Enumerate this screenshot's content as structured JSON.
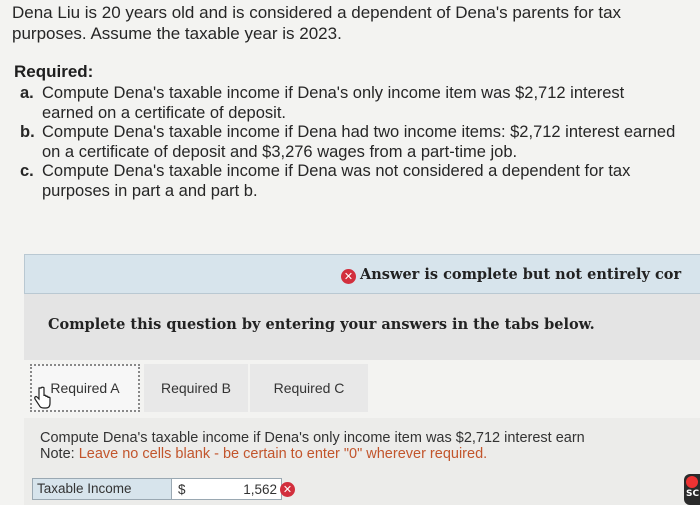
{
  "intro": "Dena Liu is 20 years old and is considered a dependent of Dena's parents for tax purposes. Assume the taxable year is 2023.",
  "required_heading": "Required:",
  "parts": [
    {
      "letter": "a.",
      "text": "Compute Dena's taxable income if Dena's only income item was $2,712 interest earned on a certificate of deposit."
    },
    {
      "letter": "b.",
      "text": "Compute Dena's taxable income if Dena had two income items: $2,712 interest earned on a certificate of deposit and $3,276 wages from a part-time job."
    },
    {
      "letter": "c.",
      "text": "Compute Dena's taxable income if Dena was not considered a dependent for tax purposes in part a and part b."
    }
  ],
  "status": {
    "message": "Answer is complete but not entirely cor",
    "icon": "x-circle-icon",
    "color": "#d22f3d"
  },
  "instruction": "Complete this question by entering your answers in the tabs below.",
  "tabs": [
    {
      "label": "Required A",
      "active": true
    },
    {
      "label": "Required B",
      "active": false
    },
    {
      "label": "Required C",
      "active": false
    }
  ],
  "panel": {
    "question": "Compute Dena's taxable income if Dena's only income item was $2,712 interest earn",
    "note_label": "Note:",
    "note_body": " Leave no cells blank - be certain to enter \"0\" wherever required.",
    "field_label": "Taxable Income",
    "currency": "$",
    "value": "1,562",
    "value_status": "incorrect"
  },
  "side_badge_text": "SC"
}
